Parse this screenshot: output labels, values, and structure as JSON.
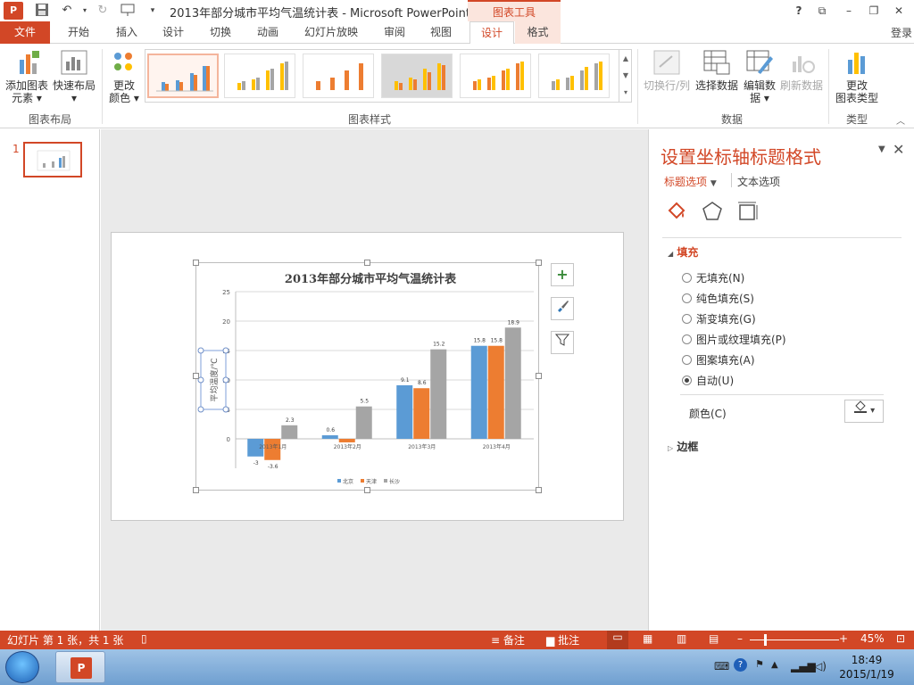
{
  "window": {
    "title": "2013年部分城市平均气温统计表 - Microsoft PowerPoint",
    "context_tools": "图表工具",
    "help": "?",
    "login": "登录",
    "controls": [
      "⧉",
      "–",
      "❐",
      "✕"
    ]
  },
  "tabs": {
    "file": "文件",
    "home": "开始",
    "insert": "插入",
    "design": "设计",
    "transitions": "切换",
    "animations": "动画",
    "slideshow": "幻灯片放映",
    "review": "审阅",
    "view": "视图",
    "chart_design": "设计",
    "chart_format": "格式"
  },
  "ribbon": {
    "add_element": "添加图表",
    "add_element_2": "元素",
    "quick_layout": "快速布局",
    "change_color": "更改",
    "change_color_2": "颜色",
    "group_layout": "图表布局",
    "group_styles": "图表样式",
    "switch_row_col": "切换行/列",
    "select_data": "选择数据",
    "edit_data": "编辑数",
    "edit_data_2": "据",
    "refresh_data": "刷新数据",
    "group_data": "数据",
    "change_type": "更改",
    "change_type_2": "图表类型",
    "group_type": "类型"
  },
  "thumbnails": {
    "slide_number": "1"
  },
  "chart_data": {
    "type": "bar",
    "title": "2013年部分城市平均气温统计表",
    "ylabel": "平均温度/℃",
    "xlabel": "",
    "ylim": [
      -5,
      25
    ],
    "yticks": [
      -5,
      0,
      5,
      10,
      15,
      20,
      25
    ],
    "ytick_labels": [
      "",
      "0",
      "5",
      "10",
      "15",
      "20",
      "25"
    ],
    "categories": [
      "2013年1月",
      "2013年2月",
      "2013年3月",
      "2013年4月"
    ],
    "series": [
      {
        "name": "北京",
        "color": "#5b9bd5",
        "values": [
          -3,
          0.6,
          9.1,
          15.8
        ]
      },
      {
        "name": "天津",
        "color": "#ed7d31",
        "values": [
          -3.6,
          -0.6,
          8.6,
          15.8
        ]
      },
      {
        "name": "长沙",
        "color": "#a5a5a5",
        "values": [
          2.3,
          5.5,
          15.2,
          18.9
        ]
      }
    ],
    "data_labels": [
      [
        "-3",
        "0.6",
        "9.1",
        "15.8"
      ],
      [
        "-3.6",
        "",
        "8.6",
        "15.8"
      ],
      [
        "2.3",
        "5.5",
        "15.2",
        "18.9"
      ]
    ],
    "grid": true,
    "legend": "bottom"
  },
  "format_pane": {
    "title": "设置坐标轴标题格式",
    "title_options": "标题选项",
    "text_options": "文本选项",
    "fill_section": "填充",
    "radio_options": [
      {
        "label": "无填充(N)",
        "selected": false
      },
      {
        "label": "纯色填充(S)",
        "selected": false
      },
      {
        "label": "渐变填充(G)",
        "selected": false
      },
      {
        "label": "图片或纹理填充(P)",
        "selected": false
      },
      {
        "label": "图案填充(A)",
        "selected": false
      },
      {
        "label": "自动(U)",
        "selected": true
      }
    ],
    "color_label": "颜色(C)",
    "border_section": "边框"
  },
  "statusbar": {
    "slide_info": "幻灯片 第 1 张，共 1 张",
    "notes": "备注",
    "comments": "批注",
    "zoom": "45%"
  },
  "taskbar": {
    "time": "18:49",
    "date": "2015/1/19"
  },
  "colors": {
    "accent": "#d24726"
  }
}
